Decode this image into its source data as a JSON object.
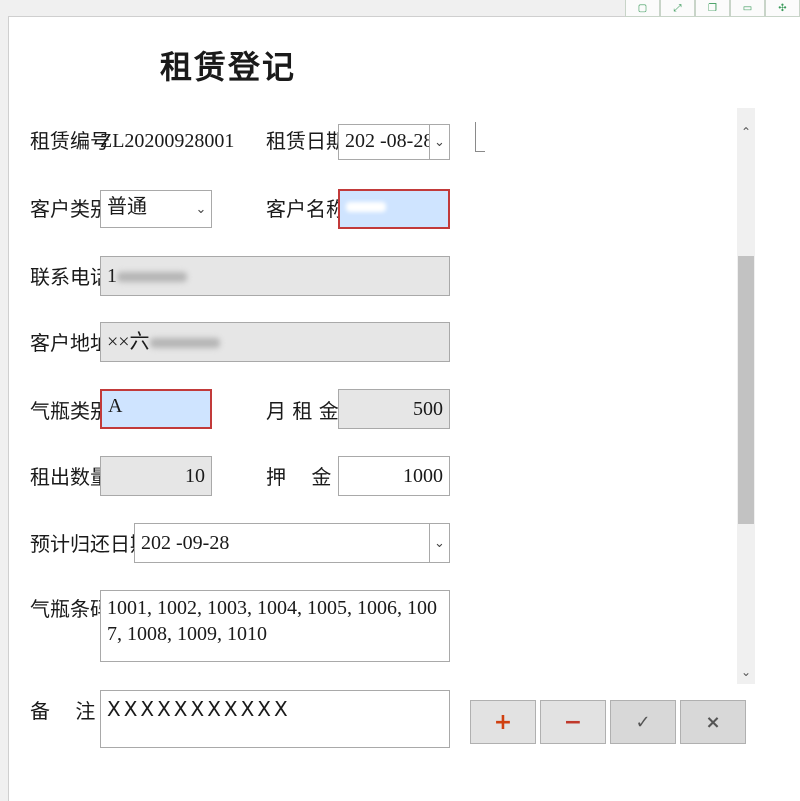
{
  "window": {
    "title": "租赁登记",
    "top_icons": [
      "window-icon-1",
      "expand-icon",
      "copy-icon",
      "window-icon-2",
      "settings-icon"
    ]
  },
  "form": {
    "rental_no": {
      "label": "租赁编号",
      "value": "ZL20200928001"
    },
    "rental_date": {
      "label": "租赁日期",
      "value": "202 -08-28"
    },
    "customer_type": {
      "label": "客户类别",
      "value": "普通"
    },
    "customer_name": {
      "label": "客户名称",
      "value": ""
    },
    "phone": {
      "label": "联系电话",
      "value": "1"
    },
    "address": {
      "label": "客户地址",
      "value": "××六"
    },
    "cylinder_type": {
      "label": "气瓶类别",
      "value": "A"
    },
    "monthly_rent": {
      "label": "月 租 金",
      "value": "500"
    },
    "rent_qty": {
      "label": "租出数量",
      "value": "10"
    },
    "deposit": {
      "label": "押    金",
      "value": "1000"
    },
    "return_date": {
      "label": "预计归还日期",
      "value": "202 -09-28"
    },
    "barcodes": {
      "label": "气瓶条码",
      "value": "1001, 1002, 1003, 1004, 1005, 1006, 1007, 1008, 1009, 1010"
    },
    "remarks": {
      "label": "备    注",
      "value": "XXXXXXXXXXX"
    }
  },
  "actions": {
    "add": "+",
    "remove": "−",
    "confirm": "✓",
    "cancel": "×"
  },
  "colors": {
    "selected_bg": "#cfe4ff",
    "selected_border": "#c23a3a",
    "add_color": "#d04010",
    "remove_color": "#c0392b"
  }
}
